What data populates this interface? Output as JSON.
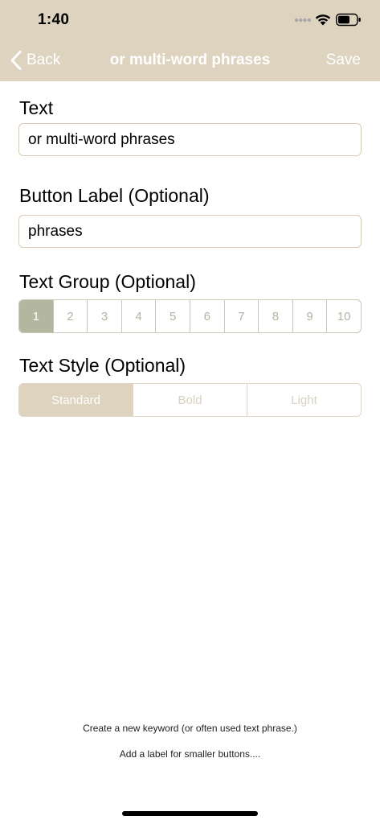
{
  "status_bar": {
    "time": "1:40"
  },
  "nav": {
    "back_label": "Back",
    "title": "or multi-word phrases",
    "save_label": "Save"
  },
  "form": {
    "text_label": "Text",
    "text_value": "or multi-word phrases",
    "button_label_label": "Button Label (Optional)",
    "button_label_value": "phrases",
    "text_group_label": "Text Group (Optional)",
    "text_group_options": [
      "1",
      "2",
      "3",
      "4",
      "5",
      "6",
      "7",
      "8",
      "9",
      "10"
    ],
    "text_group_selected": "1",
    "text_style_label": "Text Style (Optional)",
    "text_style_options": [
      "Standard",
      "Bold",
      "Light"
    ],
    "text_style_selected": "Standard"
  },
  "footer": {
    "note_1": "Create a new keyword (or often used text phrase.)",
    "note_2": "Add a label for smaller buttons...."
  },
  "colors": {
    "header_bg": "#ddd3bf",
    "group_selected": "#b4b7a0",
    "style_selected": "#ddd3bf",
    "input_border": "#dccbb2"
  },
  "icons": {
    "back": "chevron-left-icon",
    "signal": "cellular-dots-icon",
    "wifi": "wifi-icon",
    "battery": "battery-icon"
  }
}
